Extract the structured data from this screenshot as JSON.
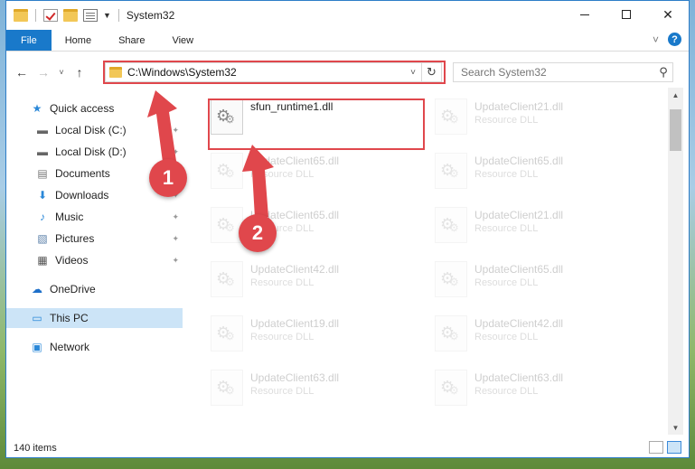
{
  "window": {
    "title": "System32",
    "close_glyph": "✕"
  },
  "ribbon": {
    "tabs": [
      "File",
      "Home",
      "Share",
      "View"
    ],
    "help": "?"
  },
  "navbar": {
    "back": "←",
    "forward": "→",
    "recent": "˅",
    "up": "↑",
    "address": "C:\\Windows\\System32",
    "address_dropdown": "˅",
    "refresh": "↻",
    "search_placeholder": "Search System32",
    "search_icon": "⚲"
  },
  "sidebar": {
    "items": [
      {
        "label": "Quick access",
        "icon": "star-icon",
        "glyph": "★",
        "color": "#2b88d8",
        "pinned": false
      },
      {
        "label": "Local Disk (C:)",
        "icon": "drive-icon",
        "glyph": "▬",
        "color": "#666666",
        "pinned": true
      },
      {
        "label": "Local Disk (D:)",
        "icon": "drive-icon",
        "glyph": "▬",
        "color": "#666666",
        "pinned": true
      },
      {
        "label": "Documents",
        "icon": "documents-icon",
        "glyph": "▤",
        "color": "#777777",
        "pinned": true
      },
      {
        "label": "Downloads",
        "icon": "download-icon",
        "glyph": "⬇",
        "color": "#2b88d8",
        "pinned": true
      },
      {
        "label": "Music",
        "icon": "music-icon",
        "glyph": "♪",
        "color": "#2b88d8",
        "pinned": true
      },
      {
        "label": "Pictures",
        "icon": "pictures-icon",
        "glyph": "▧",
        "color": "#5a7fa8",
        "pinned": true
      },
      {
        "label": "Videos",
        "icon": "videos-icon",
        "glyph": "▦",
        "color": "#555555",
        "pinned": true
      },
      {
        "label": "OneDrive",
        "icon": "cloud-icon",
        "glyph": "☁",
        "color": "#1d6fc9",
        "pinned": false
      },
      {
        "label": "This PC",
        "icon": "computer-icon",
        "glyph": "▭",
        "color": "#2b88d8",
        "pinned": false,
        "selected": true
      },
      {
        "label": "Network",
        "icon": "network-icon",
        "glyph": "▣",
        "color": "#2b88d8",
        "pinned": false
      }
    ],
    "pin_glyph": "📌"
  },
  "files": [
    {
      "name": "sfun_runtime1.dll",
      "type": "",
      "highlighted": true
    },
    {
      "name": "UpdateClient21.dll",
      "type": "Resource DLL"
    },
    {
      "name": "UpdateClient65.dll",
      "type": "Resource DLL"
    },
    {
      "name": "UpdateClient65.dll",
      "type": "Resource DLL"
    },
    {
      "name": "UpdateClient65.dll",
      "type": "Resource DLL"
    },
    {
      "name": "UpdateClient21.dll",
      "type": "Resource DLL"
    },
    {
      "name": "UpdateClient42.dll",
      "type": "Resource DLL"
    },
    {
      "name": "UpdateClient65.dll",
      "type": "Resource DLL"
    },
    {
      "name": "UpdateClient19.dll",
      "type": "Resource DLL"
    },
    {
      "name": "UpdateClient42.dll",
      "type": "Resource DLL"
    },
    {
      "name": "UpdateClient63.dll",
      "type": "Resource DLL"
    },
    {
      "name": "UpdateClient63.dll",
      "type": "Resource DLL"
    }
  ],
  "status": {
    "items_count": "140 items"
  },
  "annotations": {
    "step1": "1",
    "step2": "2",
    "color": "#e0474c"
  }
}
